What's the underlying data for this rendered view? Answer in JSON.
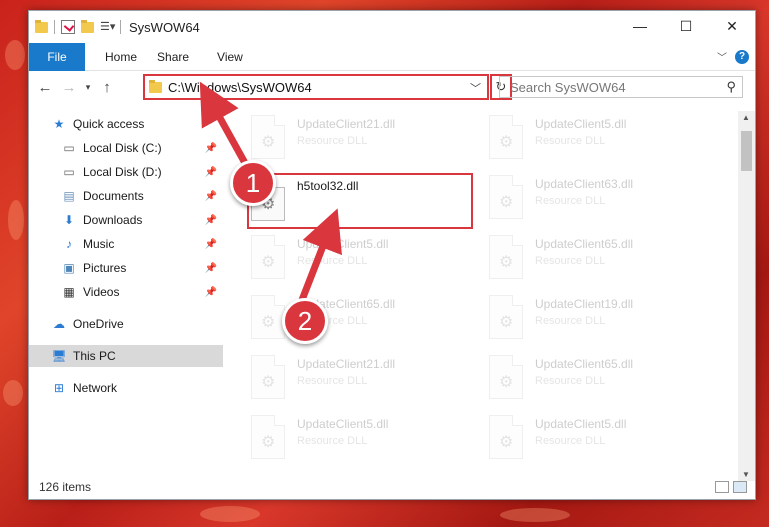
{
  "window": {
    "title": "SysWOW64"
  },
  "ribbon": {
    "file": "File",
    "tabs": [
      "Home",
      "Share",
      "View"
    ]
  },
  "address": {
    "path": "C:\\Windows\\SysWOW64"
  },
  "search": {
    "placeholder": "Search SysWOW64"
  },
  "sidebar": {
    "items": [
      {
        "label": "Quick access",
        "icon": "star-icon"
      },
      {
        "label": "Local Disk (C:)",
        "icon": "drive-icon"
      },
      {
        "label": "Local Disk (D:)",
        "icon": "drive-icon"
      },
      {
        "label": "Documents",
        "icon": "documents-icon"
      },
      {
        "label": "Downloads",
        "icon": "download-icon"
      },
      {
        "label": "Music",
        "icon": "music-icon"
      },
      {
        "label": "Pictures",
        "icon": "pictures-icon"
      },
      {
        "label": "Videos",
        "icon": "videos-icon"
      },
      {
        "label": "OneDrive",
        "icon": "cloud-icon"
      },
      {
        "label": "This PC",
        "icon": "computer-icon"
      },
      {
        "label": "Network",
        "icon": "network-icon"
      }
    ]
  },
  "files": {
    "highlighted": {
      "name": "h5tool32.dll"
    },
    "faded": [
      {
        "name": "UpdateClient21.dll",
        "type": "Resource DLL"
      },
      {
        "name": "UpdateClient5.dll",
        "type": "Resource DLL"
      },
      {
        "name": "UpdateClient63.dll",
        "type": "Resource DLL"
      },
      {
        "name": "UpdateClient5.dll",
        "type": "Resource DLL"
      },
      {
        "name": "UpdateClient65.dll",
        "type": "Resource DLL"
      },
      {
        "name": "UpdateClient65.dll",
        "type": "Resource DLL"
      },
      {
        "name": "UpdateClient19.dll",
        "type": "Resource DLL"
      },
      {
        "name": "UpdateClient21.dll",
        "type": "Resource DLL"
      },
      {
        "name": "UpdateClient65.dll",
        "type": "Resource DLL"
      },
      {
        "name": "UpdateClient5.dll",
        "type": "Resource DLL"
      },
      {
        "name": "UpdateClient5.dll",
        "type": "Resource DLL"
      }
    ]
  },
  "status": {
    "count": "126 items"
  },
  "callouts": [
    "1",
    "2"
  ],
  "colors": {
    "accent": "#1979ca",
    "highlight": "#d9363e"
  }
}
